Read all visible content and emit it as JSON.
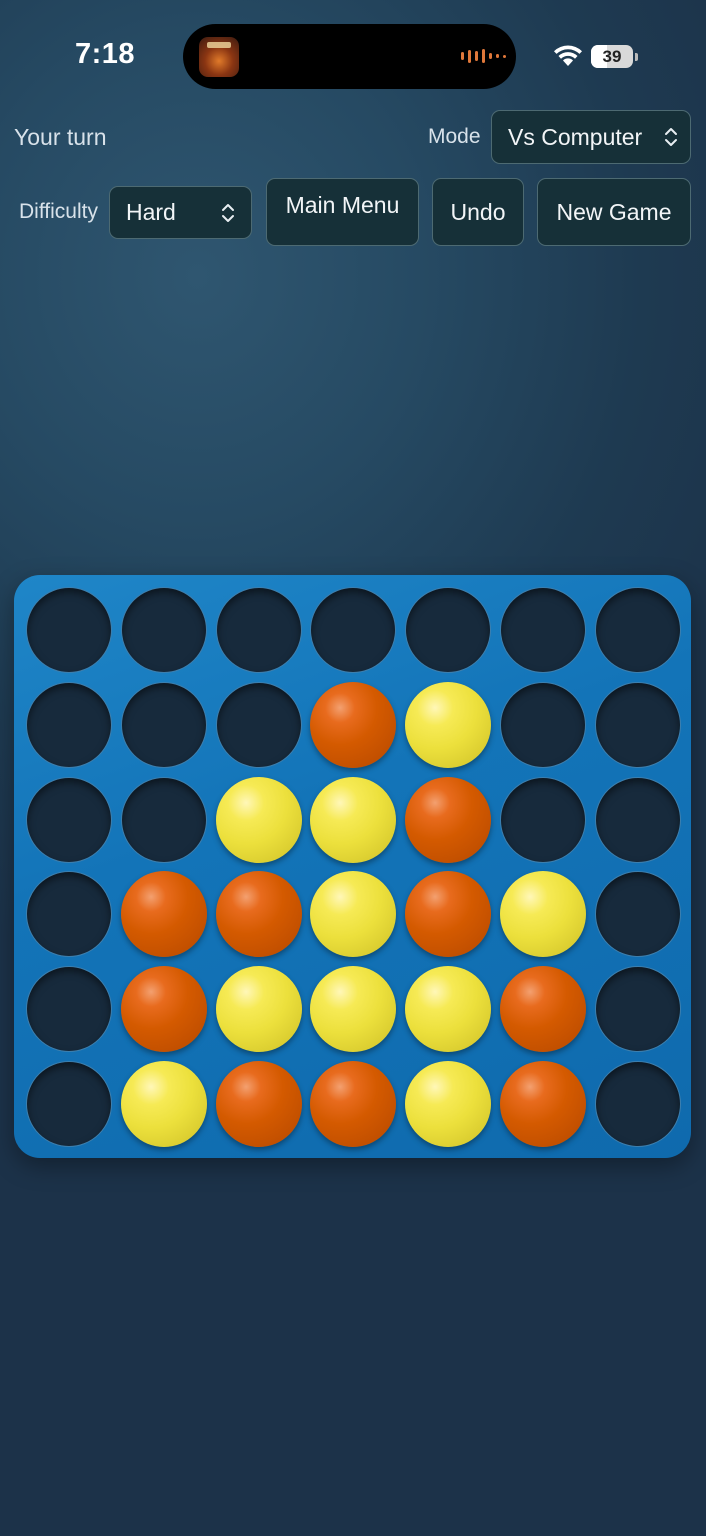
{
  "status_bar": {
    "time": "7:18",
    "battery": "39",
    "battery_level_percent": 39,
    "now_playing_icon": "app-thumbnail-icon",
    "audio_wave_color": "#e0783a"
  },
  "game": {
    "turn_text": "Your turn",
    "mode_label": "Mode",
    "mode_value": "Vs Computer",
    "difficulty_label": "Difficulty",
    "difficulty_value": "Hard",
    "buttons": {
      "main_menu": "Main Menu",
      "undo": "Undo",
      "new_game": "New Game"
    }
  },
  "board": {
    "columns": 7,
    "rows": 6,
    "colors": {
      "red": "#d45a00",
      "yellow": "#ece03c",
      "frame": "#1374b8",
      "hole": "#172a3c"
    },
    "cells": [
      [
        "empty",
        "empty",
        "empty",
        "empty",
        "empty",
        "empty",
        "empty"
      ],
      [
        "empty",
        "empty",
        "empty",
        "red",
        "yellow",
        "empty",
        "empty"
      ],
      [
        "empty",
        "empty",
        "yellow",
        "yellow",
        "red",
        "empty",
        "empty"
      ],
      [
        "empty",
        "red",
        "red",
        "yellow",
        "red",
        "yellow",
        "empty"
      ],
      [
        "empty",
        "red",
        "yellow",
        "yellow",
        "yellow",
        "red",
        "empty"
      ],
      [
        "empty",
        "yellow",
        "red",
        "red",
        "yellow",
        "red",
        "empty"
      ]
    ]
  }
}
